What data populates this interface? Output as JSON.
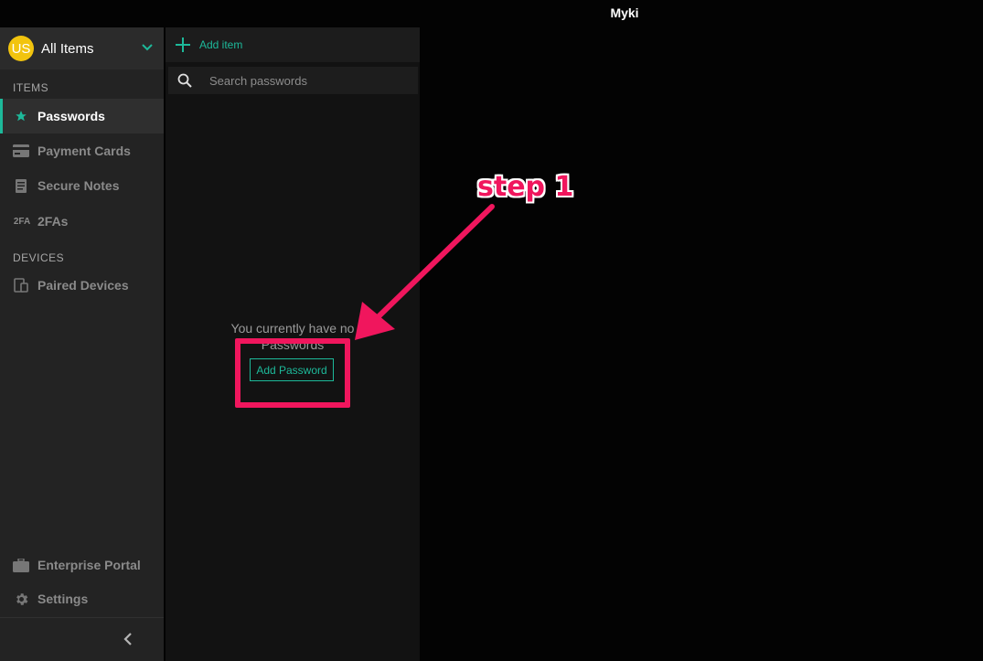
{
  "window": {
    "title": "Myki"
  },
  "vault": {
    "avatar_initials": "US",
    "name": "All Items"
  },
  "sidebar": {
    "items_section": "ITEMS",
    "items": [
      {
        "label": "Passwords",
        "icon": "star-icon",
        "active": true
      },
      {
        "label": "Payment Cards",
        "icon": "credit-card-icon"
      },
      {
        "label": "Secure Notes",
        "icon": "note-icon"
      },
      {
        "label": "2FAs",
        "icon_text": "2FA"
      }
    ],
    "devices_section": "DEVICES",
    "devices": [
      {
        "label": "Paired Devices",
        "icon": "devices-icon"
      }
    ],
    "bottom": [
      {
        "label": "Enterprise Portal",
        "icon": "briefcase-icon"
      },
      {
        "label": "Settings",
        "icon": "gear-icon"
      }
    ]
  },
  "middle": {
    "add_item_label": "Add item",
    "search_placeholder": "Search passwords",
    "empty_message": "You currently have no Passwords",
    "add_password_label": "Add Password"
  },
  "annotation": {
    "label": "step 1"
  },
  "colors": {
    "accent": "#1db99a",
    "annotation": "#f0165d",
    "avatar": "#f2c40e"
  }
}
